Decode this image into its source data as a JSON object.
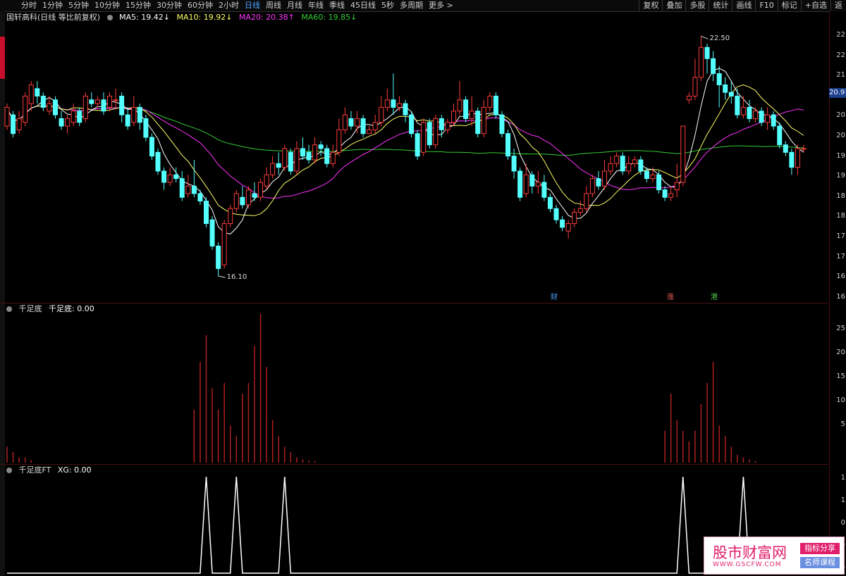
{
  "toolbar": {
    "left_items": [
      "分时",
      "1分钟",
      "5分钟",
      "10分钟",
      "15分钟",
      "30分钟",
      "60分钟",
      "2小时",
      "日线",
      "周线",
      "月线",
      "年线",
      "季线",
      "45日线",
      "5秒",
      "多周期",
      "更多 >"
    ],
    "active_index": 8,
    "right_items": [
      "复权",
      "叠加",
      "多股",
      "统计",
      "画线",
      "F10",
      "标记",
      "+自选",
      "返"
    ]
  },
  "main_pane": {
    "title": "国轩高科(日线 等比前复权)",
    "ma5": "MA5: 19.42↓",
    "ma10": "MA10: 19.92↓",
    "ma20": "MA20: 20.38↑",
    "ma60": "MA60: 19.85↓",
    "high_label": "22.50",
    "low_label": "16.10",
    "current_price": "20.91",
    "axis_labels": [
      "22",
      "22",
      "21",
      "21",
      "20",
      "20",
      "19",
      "19",
      "18",
      "18",
      "17",
      "17",
      "16",
      "16"
    ],
    "events": [
      {
        "text": "财",
        "color": "#4da3ff"
      },
      {
        "text": "涨",
        "color": "#ff6060"
      },
      {
        "text": "港",
        "color": "#4dcc4d"
      }
    ]
  },
  "pane2": {
    "title": "千足底",
    "value": "千足底: 0.00",
    "axis_labels": [
      "25",
      "20",
      "15",
      "10",
      "5"
    ]
  },
  "pane3": {
    "title": "千足底FT",
    "value": "XG: 0.00",
    "axis_labels": [
      "1",
      "1",
      "0",
      "0",
      "0"
    ]
  },
  "colors": {
    "up": "#ff3b3b",
    "down": "#54ffff",
    "ma5": "#ffffff",
    "ma10": "#ffff66",
    "ma20": "#ff33ff",
    "ma60": "#33cc33",
    "bar": "#b02020"
  },
  "watermark": {
    "main": "股市财富网",
    "tag1": "指标分享",
    "tag2": "名师课程",
    "url": "WWW.GSCFW.COM"
  },
  "chart_data": [
    {
      "type": "candlestick",
      "title": "国轩高科(日线 等比前复权)",
      "ylim": [
        15.8,
        22.9
      ],
      "note_high": 22.5,
      "note_low": 16.1,
      "candles": [
        [
          20.1,
          20.6,
          20.0,
          20.7
        ],
        [
          20.4,
          19.9,
          19.8,
          20.5
        ],
        [
          20.0,
          20.3,
          19.9,
          20.5
        ],
        [
          20.2,
          20.9,
          20.1,
          21.0
        ],
        [
          20.7,
          21.2,
          20.5,
          21.3
        ],
        [
          21.1,
          20.9,
          20.7,
          21.3
        ],
        [
          20.9,
          20.6,
          20.5,
          21.0
        ],
        [
          20.5,
          20.7,
          20.4,
          20.9
        ],
        [
          20.8,
          20.4,
          20.3,
          20.9
        ],
        [
          20.3,
          20.1,
          20.0,
          20.5
        ],
        [
          20.1,
          20.3,
          19.9,
          20.4
        ],
        [
          20.2,
          20.5,
          20.1,
          20.7
        ],
        [
          20.5,
          20.2,
          20.1,
          20.6
        ],
        [
          20.3,
          20.9,
          20.2,
          21.0
        ],
        [
          20.8,
          20.7,
          20.6,
          21.0
        ],
        [
          20.7,
          20.8,
          20.6,
          20.9
        ],
        [
          20.8,
          20.5,
          20.4,
          21.0
        ],
        [
          20.6,
          20.9,
          20.5,
          21.0
        ],
        [
          20.8,
          20.8,
          20.6,
          21.1
        ],
        [
          20.9,
          20.4,
          20.2,
          21.0
        ],
        [
          20.4,
          20.1,
          20.0,
          20.6
        ],
        [
          20.2,
          20.6,
          20.1,
          20.9
        ],
        [
          20.6,
          20.2,
          20.0,
          20.7
        ],
        [
          20.3,
          19.8,
          19.7,
          20.4
        ],
        [
          19.8,
          19.3,
          19.2,
          19.9
        ],
        [
          19.4,
          18.9,
          18.8,
          19.5
        ],
        [
          18.9,
          18.6,
          18.4,
          19.0
        ],
        [
          18.6,
          18.8,
          18.5,
          19.0
        ],
        [
          18.8,
          18.7,
          18.6,
          19.0
        ],
        [
          18.7,
          18.2,
          18.1,
          18.9
        ],
        [
          18.3,
          18.5,
          18.2,
          18.8
        ],
        [
          18.5,
          18.3,
          18.2,
          19.2
        ],
        [
          18.3,
          18.1,
          18.0,
          18.4
        ],
        [
          18.1,
          17.5,
          17.4,
          18.2
        ],
        [
          17.6,
          16.9,
          16.8,
          17.7
        ],
        [
          16.9,
          16.3,
          16.1,
          17.0
        ],
        [
          16.4,
          17.5,
          16.3,
          17.6
        ],
        [
          17.5,
          17.9,
          17.4,
          18.0
        ],
        [
          17.9,
          18.3,
          17.8,
          18.4
        ],
        [
          18.2,
          18.0,
          17.9,
          18.5
        ],
        [
          18.0,
          18.4,
          17.9,
          18.5
        ],
        [
          18.3,
          18.2,
          18.1,
          18.6
        ],
        [
          18.2,
          18.6,
          18.1,
          18.7
        ],
        [
          18.5,
          18.8,
          18.4,
          19.0
        ],
        [
          18.8,
          19.1,
          18.7,
          19.3
        ],
        [
          19.1,
          19.0,
          18.8,
          19.4
        ],
        [
          19.0,
          19.5,
          18.9,
          19.6
        ],
        [
          19.4,
          18.9,
          18.8,
          19.5
        ],
        [
          18.9,
          19.5,
          18.8,
          19.7
        ],
        [
          19.5,
          19.3,
          19.2,
          19.8
        ],
        [
          19.4,
          19.2,
          19.1,
          19.6
        ],
        [
          19.2,
          19.6,
          19.1,
          19.8
        ],
        [
          19.6,
          19.5,
          19.3,
          19.7
        ],
        [
          19.5,
          19.1,
          19.0,
          19.6
        ],
        [
          19.1,
          19.4,
          19.0,
          19.6
        ],
        [
          19.4,
          20.0,
          19.3,
          20.3
        ],
        [
          20.0,
          20.4,
          19.9,
          20.6
        ],
        [
          20.3,
          20.1,
          20.0,
          20.5
        ],
        [
          20.1,
          20.3,
          19.9,
          20.5
        ],
        [
          20.3,
          19.9,
          19.8,
          20.4
        ],
        [
          19.9,
          20.0,
          19.9,
          20.1
        ],
        [
          20.0,
          20.2,
          19.9,
          20.4
        ],
        [
          20.2,
          20.6,
          20.1,
          20.9
        ],
        [
          20.6,
          20.8,
          20.5,
          21.1
        ],
        [
          20.8,
          20.6,
          20.4,
          21.5
        ],
        [
          20.6,
          20.7,
          20.5,
          20.9
        ],
        [
          20.7,
          20.4,
          20.2,
          20.8
        ],
        [
          20.4,
          19.9,
          19.8,
          20.5
        ],
        [
          19.9,
          19.3,
          19.2,
          20.0
        ],
        [
          19.4,
          20.2,
          19.3,
          20.3
        ],
        [
          20.2,
          19.6,
          19.5,
          20.3
        ],
        [
          19.6,
          20.3,
          19.5,
          20.4
        ],
        [
          20.3,
          20.0,
          19.8,
          20.4
        ],
        [
          20.0,
          20.2,
          19.9,
          20.3
        ],
        [
          20.2,
          20.5,
          20.1,
          20.7
        ],
        [
          20.5,
          20.8,
          20.4,
          21.3
        ],
        [
          20.8,
          20.3,
          20.2,
          20.9
        ],
        [
          20.3,
          20.5,
          20.1,
          20.9
        ],
        [
          20.5,
          19.9,
          19.8,
          20.6
        ],
        [
          19.9,
          20.6,
          19.8,
          20.8
        ],
        [
          20.6,
          20.9,
          20.5,
          21.0
        ],
        [
          20.9,
          20.4,
          20.3,
          21.0
        ],
        [
          20.4,
          19.9,
          19.8,
          20.5
        ],
        [
          19.9,
          19.3,
          19.2,
          20.0
        ],
        [
          19.3,
          18.9,
          18.7,
          19.5
        ],
        [
          18.9,
          18.2,
          18.1,
          19.0
        ],
        [
          18.3,
          18.8,
          18.2,
          19.1
        ],
        [
          18.8,
          18.5,
          18.3,
          18.9
        ],
        [
          18.5,
          18.6,
          18.3,
          18.9
        ],
        [
          18.6,
          18.2,
          18.1,
          18.8
        ],
        [
          18.2,
          17.9,
          17.8,
          18.3
        ],
        [
          17.9,
          17.6,
          17.5,
          18.0
        ],
        [
          17.6,
          17.4,
          17.3,
          17.7
        ],
        [
          17.3,
          17.5,
          17.1,
          17.6
        ],
        [
          17.5,
          17.8,
          17.4,
          17.9
        ],
        [
          17.8,
          17.9,
          17.7,
          18.1
        ],
        [
          17.9,
          18.3,
          17.8,
          18.5
        ],
        [
          18.3,
          18.7,
          18.2,
          18.8
        ],
        [
          18.7,
          18.5,
          18.4,
          18.9
        ],
        [
          18.5,
          18.9,
          18.4,
          19.2
        ],
        [
          18.9,
          19.1,
          18.8,
          19.3
        ],
        [
          19.1,
          19.3,
          19.0,
          19.4
        ],
        [
          19.3,
          18.9,
          18.8,
          19.4
        ],
        [
          18.9,
          19.1,
          18.8,
          19.3
        ],
        [
          19.1,
          19.2,
          19.0,
          19.3
        ],
        [
          19.2,
          18.9,
          18.8,
          19.3
        ],
        [
          18.9,
          18.7,
          18.6,
          19.0
        ],
        [
          18.7,
          18.8,
          18.6,
          19.0
        ],
        [
          18.8,
          18.4,
          18.3,
          18.9
        ],
        [
          18.4,
          18.2,
          18.1,
          18.5
        ],
        [
          18.2,
          18.3,
          18.1,
          18.5
        ],
        [
          18.4,
          18.6,
          18.2,
          19.1
        ],
        [
          18.6,
          20.1,
          18.5,
          20.1
        ],
        [
          20.8,
          20.9,
          20.7,
          21.0
        ],
        [
          20.9,
          21.4,
          20.8,
          21.9
        ],
        [
          21.4,
          22.2,
          21.3,
          22.5
        ],
        [
          22.2,
          21.9,
          21.5,
          22.3
        ],
        [
          21.9,
          21.5,
          21.3,
          22.1
        ],
        [
          21.5,
          21.2,
          20.6,
          21.7
        ],
        [
          21.2,
          21.0,
          20.8,
          21.4
        ],
        [
          21.0,
          20.9,
          20.7,
          21.3
        ],
        [
          20.9,
          20.4,
          20.3,
          21.1
        ],
        [
          20.4,
          20.6,
          20.3,
          20.9
        ],
        [
          20.6,
          20.3,
          20.2,
          20.8
        ],
        [
          20.3,
          20.5,
          20.2,
          20.6
        ],
        [
          20.5,
          20.2,
          20.1,
          20.6
        ],
        [
          20.2,
          20.4,
          20.0,
          20.6
        ],
        [
          20.4,
          20.1,
          20.0,
          20.5
        ],
        [
          20.1,
          19.6,
          19.5,
          20.2
        ],
        [
          19.6,
          19.4,
          19.3,
          19.7
        ],
        [
          19.4,
          19.0,
          18.8,
          19.5
        ],
        [
          19.0,
          19.5,
          18.8,
          19.6
        ],
        [
          19.5,
          19.5,
          19.4,
          19.6
        ]
      ]
    },
    {
      "type": "bar",
      "title": "千足底",
      "ylim": [
        0,
        28
      ],
      "values_by_index": {
        "0": 3,
        "1": 2,
        "2": 1,
        "3": 1,
        "4": 0.5,
        "31": 10,
        "32": 19,
        "33": 24,
        "34": 14,
        "35": 10,
        "36": 15,
        "37": 7,
        "38": 5,
        "39": 13,
        "40": 15,
        "41": 22,
        "42": 28,
        "43": 18,
        "44": 8,
        "45": 5,
        "46": 3,
        "47": 2,
        "48": 1,
        "49": 0.6,
        "50": 0.4,
        "51": 0.3,
        "109": 6,
        "110": 13,
        "111": 8,
        "112": 6,
        "113": 4,
        "114": 6,
        "115": 11,
        "116": 15,
        "117": 19,
        "118": 7,
        "119": 5,
        "120": 3,
        "121": 1.5,
        "122": 1,
        "123": 0.6,
        "124": 0.3
      }
    },
    {
      "type": "line",
      "title": "千足底FT",
      "ylim": [
        0,
        1.1
      ],
      "peaks_at_index": [
        33,
        38,
        46,
        112,
        122
      ]
    }
  ]
}
